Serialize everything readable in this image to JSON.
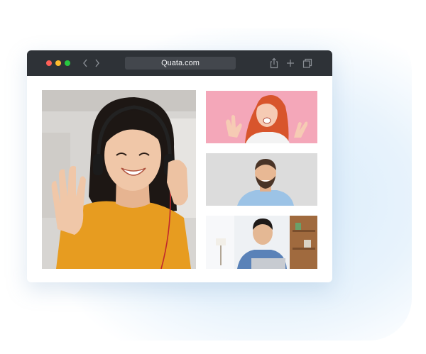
{
  "browser": {
    "url": "Quata.com",
    "colors": {
      "toolbar": "#2e3237",
      "close": "#ff5f57",
      "minimize": "#febc2e",
      "maximize": "#28c840"
    }
  },
  "video_call": {
    "participants": [
      {
        "tile": "main-speaker",
        "background": "#d9d7d4"
      },
      {
        "tile": "participant-1",
        "background": "#f4a7b9"
      },
      {
        "tile": "participant-2",
        "background": "#dcdcdc"
      },
      {
        "tile": "participant-3",
        "background": "#eef1f4"
      }
    ]
  }
}
